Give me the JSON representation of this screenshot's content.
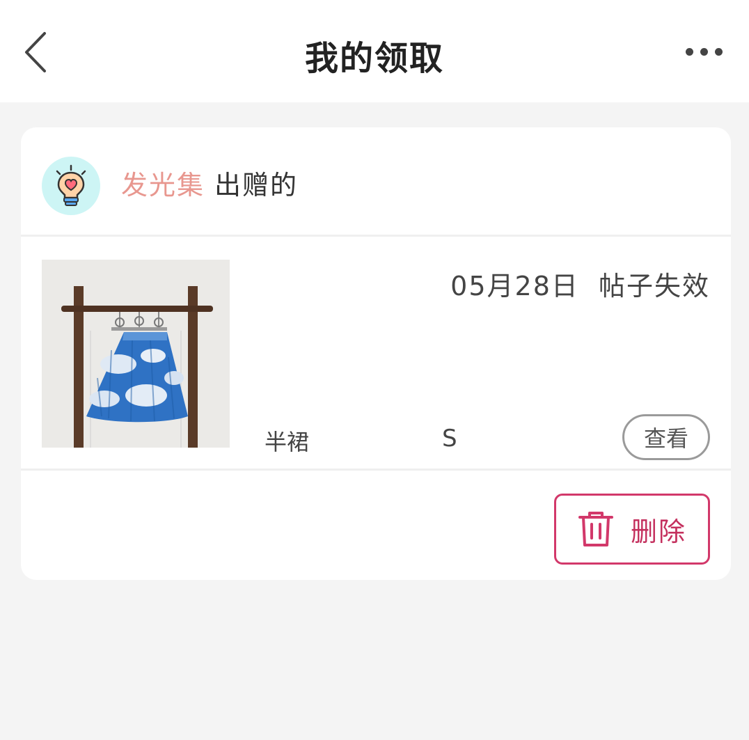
{
  "header": {
    "title": "我的领取",
    "back_icon": "chevron-left-icon",
    "more_icon": "more-dots-icon"
  },
  "card": {
    "owner": {
      "avatar_icon": "lightbulb-heart-icon",
      "name": "发光集",
      "action": "出赠的"
    },
    "item": {
      "date": "05月28日",
      "status": "帖子失效",
      "name": "半裙",
      "size": "S",
      "view_label": "查看"
    },
    "delete_label": "删除",
    "delete_icon": "trash-icon"
  },
  "colors": {
    "accent": "#d2386a",
    "owner_name": "#e8978f",
    "avatar_bg": "#cdf5f5",
    "page_bg": "#f4f4f4"
  }
}
